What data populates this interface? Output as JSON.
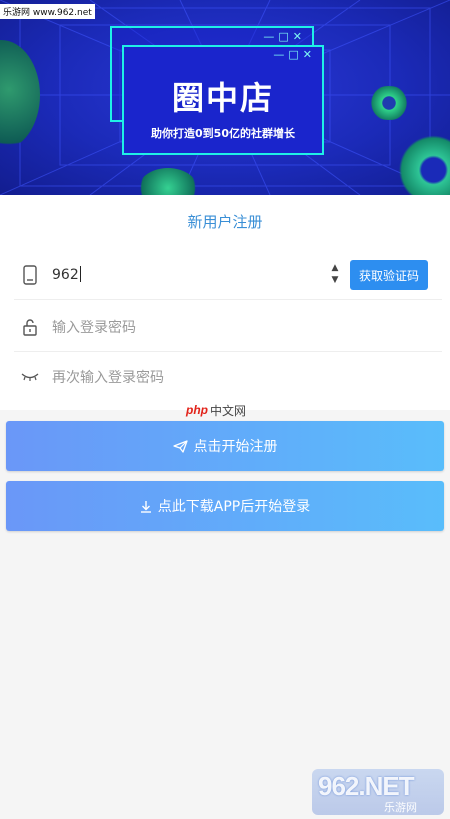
{
  "watermark_top": "乐游网 www.962.net",
  "banner": {
    "title": "圈中店",
    "subtitle": "助你打造0到50亿的社群增长",
    "window_controls": "—□✕"
  },
  "form": {
    "title": "新用户注册",
    "phone_value": "962",
    "send_code_label": "获取验证码",
    "password_placeholder": "输入登录密码",
    "confirm_placeholder": "再次输入登录密码"
  },
  "overlay_logo": {
    "php": "php",
    "text": "中文网"
  },
  "buttons": {
    "register_label": "点击开始注册",
    "download_label": "点此下载APP后开始登录"
  },
  "watermark_br": {
    "big": "962.NET",
    "sub": "乐游网"
  },
  "colors": {
    "accent": "#2d8ef0",
    "title": "#3a8fd6",
    "banner": "#1b2ab8",
    "neon": "#1ff0e6"
  },
  "icons": [
    "phone-icon",
    "lock-icon",
    "eye-closed-icon",
    "send-icon",
    "download-icon"
  ]
}
